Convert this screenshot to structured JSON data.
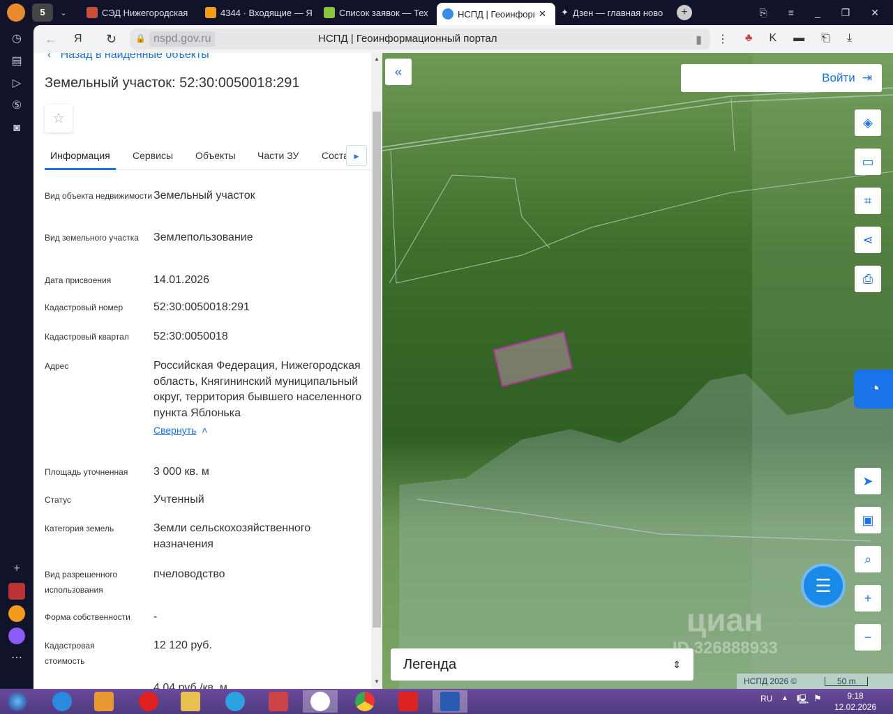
{
  "browser": {
    "tab_count": "5",
    "tabs": [
      {
        "label": "СЭД Нижегородская",
        "color": "#c8503a"
      },
      {
        "label": "4344 · Входящие — Я",
        "color": "#f29b1d"
      },
      {
        "label": "Список заявок — Тех",
        "color": "#8cc63f"
      },
      {
        "label": "НСПД | Геоинформ",
        "color": "#3b8be8",
        "active": true
      },
      {
        "label": "Дзен — главная ново",
        "color": "#ffffff"
      }
    ],
    "url": "nspd.gov.ru",
    "page_title": "НСПД | Геоинформационный портал"
  },
  "panel": {
    "back_link": "Назад в найденные объекты",
    "title": "Земельный участок: 52:30:0050018:291",
    "tabs": [
      "Информация",
      "Сервисы",
      "Объекты",
      "Части ЗУ",
      "Соста"
    ],
    "active_tab": 0,
    "collapse_link": "Свернуть",
    "fields": [
      {
        "label": "Вид объекта недвижимости",
        "value": "Земельный участок"
      },
      {
        "label": "Вид земельного участка",
        "value": "Землепользование"
      },
      {
        "label": "Дата присвоения",
        "value": "14.01.2026"
      },
      {
        "label": "Кадастровый номер",
        "value": "52:30:0050018:291"
      },
      {
        "label": "Кадастровый квартал",
        "value": "52:30:0050018"
      },
      {
        "label": "Адрес",
        "value": "Российская Федерация, Нижегородская область, Княгининский муниципальный округ, территория бывшего населенного пункта Яблонька"
      },
      {
        "label": "Площадь уточненная",
        "value": "3 000 кв. м"
      },
      {
        "label": "Статус",
        "value": "Учтенный"
      },
      {
        "label": "Категория земель",
        "value": "Земли сельскохозяйственного назначения"
      },
      {
        "label": "Вид разрешенного использования",
        "value": "пчеловодство"
      },
      {
        "label": "Форма собственности",
        "value": "-"
      },
      {
        "label": "Кадастровая стоимость",
        "value": "12 120 руб."
      },
      {
        "label": "",
        "value": "4,04 руб./кв. м"
      }
    ]
  },
  "map": {
    "login": "Войти",
    "legend": "Легенда",
    "copyright": "НСПД 2026 ©",
    "scale": "50 m",
    "watermark": "циан",
    "watermark_id": "ID 326888933",
    "parcel_color": "#b0359e"
  },
  "taskbar": {
    "lang": "RU",
    "time": "9:18",
    "date": "12.02.2026"
  }
}
